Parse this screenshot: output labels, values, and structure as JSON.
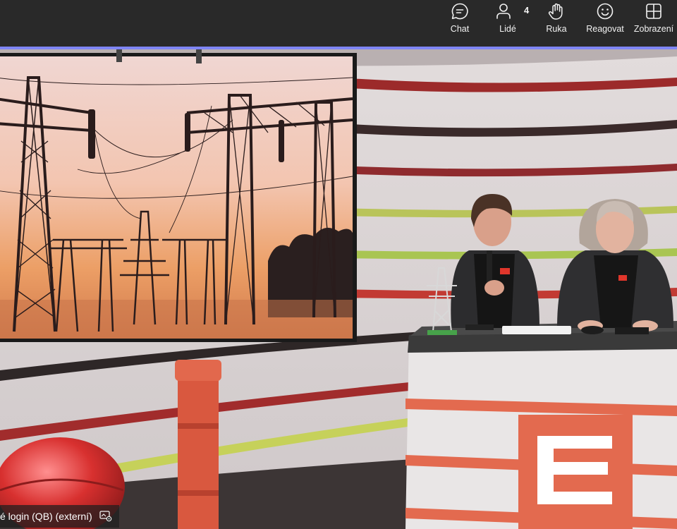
{
  "toolbar": {
    "chat_label": "Chat",
    "people_label": "Lidé",
    "people_count": "4",
    "hand_label": "Ruka",
    "react_label": "Reagovat",
    "view_label": "Zobrazení"
  },
  "participant": {
    "name": "é login (QB) (externí)",
    "status_icon": "screen-share-settings-icon"
  },
  "colors": {
    "toolbar_bg": "#292929",
    "accent": "#7f85f5",
    "brand_orange": "#e36a4f"
  }
}
